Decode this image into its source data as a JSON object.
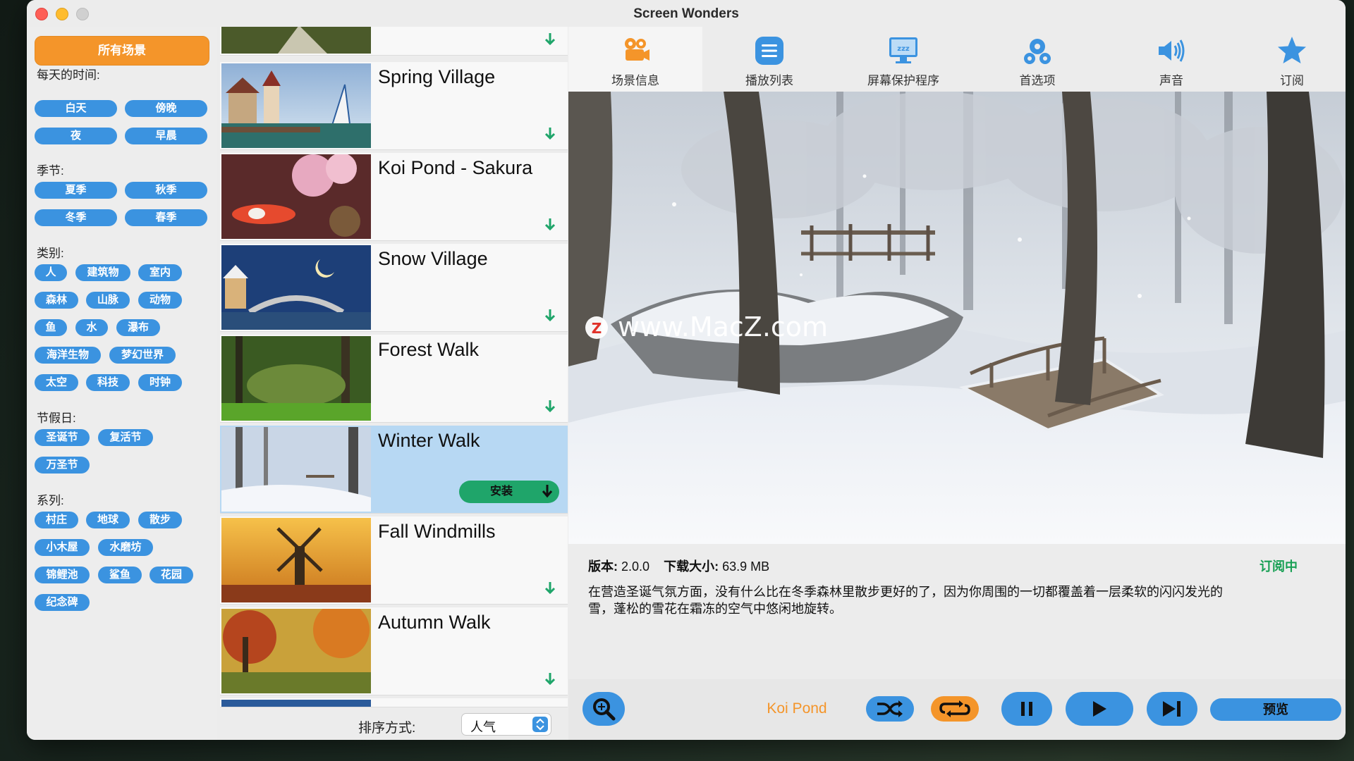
{
  "window": {
    "title": "Screen Wonders"
  },
  "sidebar": {
    "all_scenes": "所有场景",
    "sections": [
      {
        "label": "每天的时间:",
        "items": [
          "白天",
          "傍晚",
          "夜",
          "早晨"
        ]
      },
      {
        "label": "季节:",
        "items": [
          "夏季",
          "秋季",
          "冬季",
          "春季"
        ]
      },
      {
        "label": "类别:",
        "items": [
          "人",
          "建筑物",
          "室内",
          "森林",
          "山脉",
          "动物",
          "鱼",
          "水",
          "瀑布",
          "海洋生物",
          "梦幻世界",
          "太空",
          "科技",
          "时钟"
        ]
      },
      {
        "label": "节假日:",
        "items": [
          "圣诞节",
          "复活节",
          "万圣节"
        ]
      },
      {
        "label": "系列:",
        "items": [
          "村庄",
          "地球",
          "散步",
          "小木屋",
          "水磨坊",
          "锦鲤池",
          "鲨鱼",
          "花园",
          "纪念碑"
        ]
      }
    ]
  },
  "scene_list": {
    "items": [
      {
        "name": "Spring Village"
      },
      {
        "name": "Koi Pond - Sakura"
      },
      {
        "name": "Snow Village"
      },
      {
        "name": "Forest Walk"
      },
      {
        "name": "Winter Walk",
        "selected": true,
        "install_label": "安装"
      },
      {
        "name": "Fall Windmills"
      },
      {
        "name": "Autumn Walk"
      }
    ],
    "sort_label": "排序方式:",
    "sort_value": "人气"
  },
  "toolbar": {
    "items": [
      {
        "label": "场景信息",
        "icon": "camera-icon",
        "active": true
      },
      {
        "label": "播放列表",
        "icon": "playlist-icon"
      },
      {
        "label": "屏幕保护程序",
        "icon": "screensaver-icon"
      },
      {
        "label": "首选项",
        "icon": "gears-icon"
      },
      {
        "label": "声音",
        "icon": "speaker-icon"
      },
      {
        "label": "订阅",
        "icon": "star-icon"
      }
    ]
  },
  "preview": {
    "watermark": "www.MacZ.com",
    "watermark_badge": "Z"
  },
  "info": {
    "version_label": "版本:",
    "version": "2.0.0",
    "size_label": "下载大小:",
    "size": "63.9 MB",
    "subscription_status": "订阅中",
    "description": "在营造圣诞气氛方面，没有什么比在冬季森林里散步更好的了，因为你周围的一切都覆盖着一层柔软的闪闪发光的雪，蓬松的雪花在霜冻的空气中悠闲地旋转。"
  },
  "player": {
    "now_playing": "Koi Pond",
    "preview_label": "预览"
  },
  "colors": {
    "accent_blue": "#3b93e0",
    "accent_orange": "#f4952a",
    "install_green": "#1fa56a"
  }
}
